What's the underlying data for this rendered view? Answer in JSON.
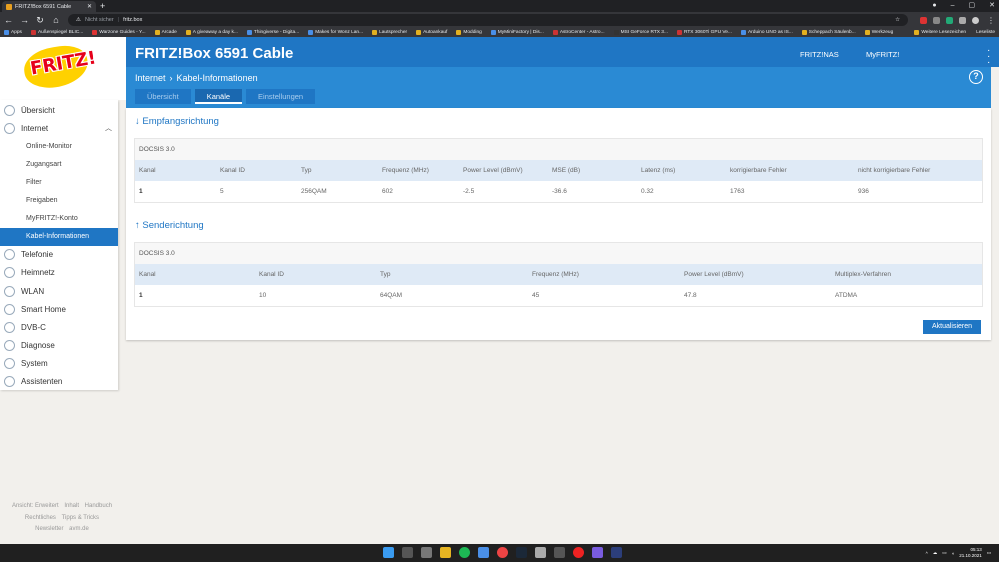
{
  "browser": {
    "tab_title": "FRITZ!Box 6591 Cable",
    "not_secure": "Nicht sicher",
    "url": "fritz.box",
    "bookmarks": [
      "Apps",
      "Außenspiegel BLIC...",
      "Warzone Guides - Y...",
      "Arcade",
      "A giveaway a day k...",
      "Thingiverse - Digita...",
      "Makes for Wonz Lan...",
      "Lautsprecher",
      "Autoankauf",
      "Modding",
      "MyMiniFactory | Dis...",
      "AstroCenter - Astro...",
      "MSI GeForce RTX 3...",
      "RTX 3060Ti GPU Ve...",
      "Arduino UNO as IS...",
      "Scheppach Säulenb...",
      "Werkzeug"
    ],
    "bookmarks_right": [
      "Weitere Lesezeichen",
      "Leseliste"
    ]
  },
  "header": {
    "logo_text": "FRITZ!",
    "title": "FRITZ!Box 6591 Cable",
    "nav": [
      "FRITZ!NAS",
      "MyFRITZ!"
    ]
  },
  "breadcrumb": {
    "parent": "Internet",
    "current": "Kabel-Informationen"
  },
  "help": "?",
  "tabs": [
    {
      "label": "Übersicht",
      "active": false
    },
    {
      "label": "Kanäle",
      "active": true
    },
    {
      "label": "Einstellungen",
      "active": false
    }
  ],
  "downstream": {
    "title": "↓ Empfangsrichtung",
    "caption": "DOCSIS 3.0",
    "headers": [
      "Kanal",
      "Kanal ID",
      "Typ",
      "Frequenz (MHz)",
      "Power Level (dBmV)",
      "MSE (dB)",
      "Latenz (ms)",
      "korrigierbare Fehler",
      "nicht korrigierbare Fehler"
    ],
    "rows": [
      [
        "1",
        "5",
        "256QAM",
        "602",
        "-2.5",
        "-36.6",
        "0.32",
        "1763",
        "936"
      ]
    ]
  },
  "upstream": {
    "title": "↑ Senderichtung",
    "caption": "DOCSIS 3.0",
    "headers": [
      "Kanal",
      "Kanal ID",
      "Typ",
      "Frequenz (MHz)",
      "Power Level (dBmV)",
      "Multiplex-Verfahren"
    ],
    "rows": [
      [
        "1",
        "10",
        "64QAM",
        "45",
        "47.8",
        "ATDMA"
      ]
    ]
  },
  "refresh_button": "Aktualisieren",
  "sidebar": {
    "items": [
      {
        "label": "Übersicht",
        "level": 0
      },
      {
        "label": "Internet",
        "level": 0,
        "expanded": true
      },
      {
        "label": "Online-Monitor",
        "level": 1
      },
      {
        "label": "Zugangsart",
        "level": 1
      },
      {
        "label": "Filter",
        "level": 1
      },
      {
        "label": "Freigaben",
        "level": 1
      },
      {
        "label": "MyFRITZ!-Konto",
        "level": 1
      },
      {
        "label": "Kabel-Informationen",
        "level": 1,
        "selected": true
      },
      {
        "label": "Telefonie",
        "level": 0
      },
      {
        "label": "Heimnetz",
        "level": 0
      },
      {
        "label": "WLAN",
        "level": 0
      },
      {
        "label": "Smart Home",
        "level": 0
      },
      {
        "label": "DVB-C",
        "level": 0
      },
      {
        "label": "Diagnose",
        "level": 0
      },
      {
        "label": "System",
        "level": 0
      },
      {
        "label": "Assistenten",
        "level": 0
      }
    ]
  },
  "footer": {
    "line1": [
      "Ansicht: Erweitert",
      "Inhalt",
      "Handbuch"
    ],
    "line2": [
      "Rechtliches",
      "Tipps & Tricks"
    ],
    "line3": [
      "Newsletter",
      "avm.de"
    ]
  },
  "taskbar": {
    "time": "05:13",
    "date": "21.10.2021"
  }
}
